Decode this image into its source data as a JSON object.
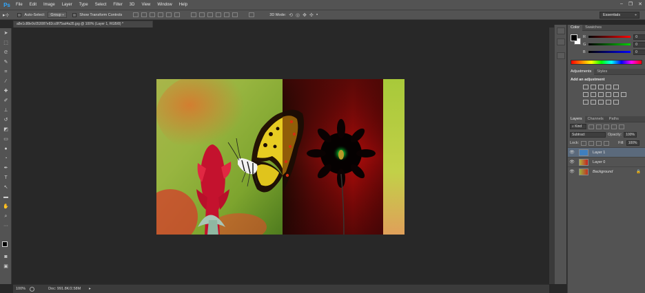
{
  "app": {
    "logo": "Ps"
  },
  "menu": [
    "File",
    "Edit",
    "Image",
    "Layer",
    "Type",
    "Select",
    "Filter",
    "3D",
    "View",
    "Window",
    "Help"
  ],
  "window_controls": {
    "minimize": "–",
    "restore": "❐",
    "close": "✕"
  },
  "options_bar": {
    "auto_select_label": "Auto-Select:",
    "auto_select_value": "Group",
    "show_transform_label": "Show Transform Controls",
    "mode_3d_label": "3D Mode:",
    "workspace": "Essentials"
  },
  "document": {
    "tab_title": "a8e1c88e9c053087e82cc8f75ad4a35.jpg @ 100% (Layer 1, RGB/8) *"
  },
  "status": {
    "zoom": "100%",
    "doc": "Doc: 991.8K/2.58M"
  },
  "color_panel": {
    "tabs": [
      "Color",
      "Swatches"
    ],
    "channels": [
      {
        "label": "R",
        "value": "0",
        "color": "#ff0000"
      },
      {
        "label": "G",
        "value": "0",
        "color": "#00c000"
      },
      {
        "label": "B",
        "value": "0",
        "color": "#0000ff"
      }
    ]
  },
  "adjustments_panel": {
    "tabs": [
      "Adjustments",
      "Styles"
    ],
    "title": "Add an adjustment"
  },
  "layers_panel": {
    "tabs": [
      "Layers",
      "Channels",
      "Paths"
    ],
    "filter_kind": "Kind",
    "blend_mode": "Subtract",
    "opacity_label": "Opacity:",
    "opacity_value": "100%",
    "lock_label": "Lock:",
    "fill_label": "Fill:",
    "fill_value": "100%",
    "layers": [
      {
        "name": "Layer 1",
        "selected": true
      },
      {
        "name": "Layer 0",
        "selected": false
      },
      {
        "name": "Background",
        "selected": false
      }
    ]
  },
  "colors": {
    "accent": "#31a8ff",
    "selection": "#5b6a7c"
  }
}
